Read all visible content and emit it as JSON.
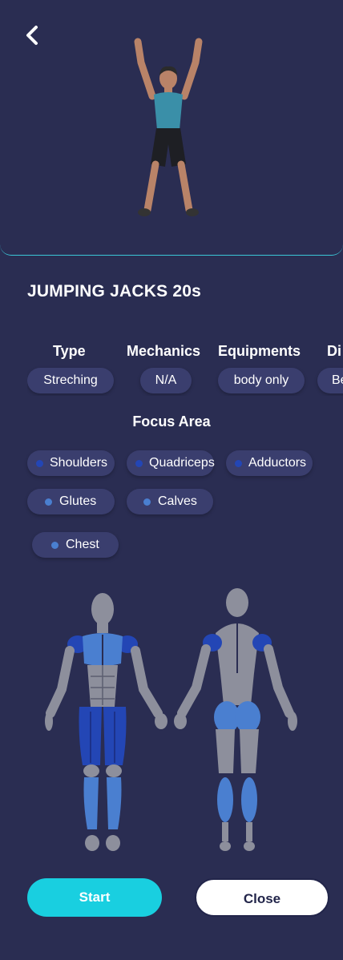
{
  "exercise": {
    "title": "JUMPING JACKS 20s"
  },
  "properties": [
    {
      "label": "Type",
      "value": "Streching"
    },
    {
      "label": "Mechanics",
      "value": "N/A"
    },
    {
      "label": "Equipments",
      "value": "body only"
    },
    {
      "label": "Di",
      "value": "Be"
    }
  ],
  "focus": {
    "title": "Focus Area",
    "areas": [
      {
        "label": "Shoulders",
        "dot_color": "#2346b5"
      },
      {
        "label": "Quadriceps",
        "dot_color": "#2346b5"
      },
      {
        "label": "Adductors",
        "dot_color": "#2346b5"
      },
      {
        "label": "Glutes",
        "dot_color": "#4a7fd0"
      },
      {
        "label": "Calves",
        "dot_color": "#4a7fd0"
      },
      {
        "label": "Chest",
        "dot_color": "#4a7fd0"
      }
    ]
  },
  "actions": {
    "start_label": "Start",
    "close_label": "Close"
  },
  "icons": {
    "back": "chevron-left-icon",
    "exercise": "jumping-jack-figure",
    "muscle_map": "muscle-map-front-back"
  },
  "colors": {
    "background": "#2a2d52",
    "accent": "#19cfe0",
    "pill": "#3a3e6e",
    "muscle_primary": "#2346b5",
    "muscle_secondary": "#4a7fd0"
  }
}
